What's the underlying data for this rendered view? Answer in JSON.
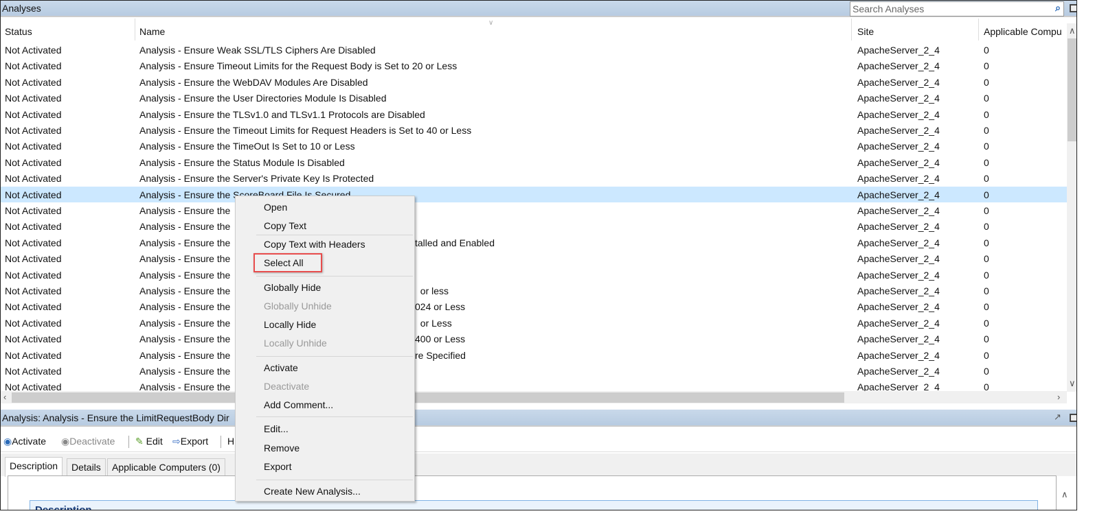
{
  "title": "Analyses",
  "search": {
    "placeholder": "Search Analyses",
    "icon": "search-icon"
  },
  "columns": [
    "Status",
    "Name",
    "Site",
    "Applicable Compu"
  ],
  "rows": [
    {
      "status": "Not Activated",
      "name": "Analysis - Ensure Weak SSL/TLS Ciphers Are Disabled",
      "suffix": "",
      "site": "ApacheServer_2_4",
      "count": "0"
    },
    {
      "status": "Not Activated",
      "name": "Analysis - Ensure Timeout Limits for the Request Body is Set to 20 or Less",
      "suffix": "",
      "site": "ApacheServer_2_4",
      "count": "0"
    },
    {
      "status": "Not Activated",
      "name": "Analysis - Ensure the WebDAV Modules Are Disabled",
      "suffix": "",
      "site": "ApacheServer_2_4",
      "count": "0"
    },
    {
      "status": "Not Activated",
      "name": "Analysis - Ensure the User Directories Module Is Disabled",
      "suffix": "",
      "site": "ApacheServer_2_4",
      "count": "0"
    },
    {
      "status": "Not Activated",
      "name": "Analysis - Ensure the TLSv1.0 and TLSv1.1 Protocols are Disabled",
      "suffix": "",
      "site": "ApacheServer_2_4",
      "count": "0"
    },
    {
      "status": "Not Activated",
      "name": "Analysis - Ensure the Timeout Limits for Request Headers is Set to 40 or Less",
      "suffix": "",
      "site": "ApacheServer_2_4",
      "count": "0"
    },
    {
      "status": "Not Activated",
      "name": "Analysis - Ensure the TimeOut Is Set to 10 or Less",
      "suffix": "",
      "site": "ApacheServer_2_4",
      "count": "0"
    },
    {
      "status": "Not Activated",
      "name": "Analysis - Ensure the Status Module Is Disabled",
      "suffix": "",
      "site": "ApacheServer_2_4",
      "count": "0"
    },
    {
      "status": "Not Activated",
      "name": "Analysis - Ensure the Server's Private Key Is Protected",
      "suffix": "",
      "site": "ApacheServer_2_4",
      "count": "0"
    },
    {
      "status": "Not Activated",
      "name": "Analysis - Ensure the ScoreBoard File Is Secured",
      "suffix": "",
      "site": "ApacheServer_2_4",
      "count": "0",
      "selected": true
    },
    {
      "status": "Not Activated",
      "name": "Analysis - Ensure the",
      "suffix": "",
      "site": "ApacheServer_2_4",
      "count": "0"
    },
    {
      "status": "Not Activated",
      "name": "Analysis - Ensure the",
      "suffix": "",
      "site": "ApacheServer_2_4",
      "count": "0"
    },
    {
      "status": "Not Activated",
      "name": "Analysis - Ensure the",
      "suffix": "talled and Enabled",
      "site": "ApacheServer_2_4",
      "count": "0"
    },
    {
      "status": "Not Activated",
      "name": "Analysis - Ensure the",
      "suffix": "",
      "site": "ApacheServer_2_4",
      "count": "0"
    },
    {
      "status": "Not Activated",
      "name": "Analysis - Ensure the",
      "suffix": "",
      "site": "ApacheServer_2_4",
      "count": "0"
    },
    {
      "status": "Not Activated",
      "name": "Analysis - Ensure the",
      "suffix": "  or less",
      "site": "ApacheServer_2_4",
      "count": "0"
    },
    {
      "status": "Not Activated",
      "name": "Analysis - Ensure the",
      "suffix": "024 or Less",
      "site": "ApacheServer_2_4",
      "count": "0"
    },
    {
      "status": "Not Activated",
      "name": "Analysis - Ensure the",
      "suffix": "  or Less",
      "site": "ApacheServer_2_4",
      "count": "0"
    },
    {
      "status": "Not Activated",
      "name": "Analysis - Ensure the",
      "suffix": "400 or Less",
      "site": "ApacheServer_2_4",
      "count": "0"
    },
    {
      "status": "Not Activated",
      "name": "Analysis - Ensure the",
      "suffix": "re Specified",
      "site": "ApacheServer_2_4",
      "count": "0"
    },
    {
      "status": "Not Activated",
      "name": "Analysis - Ensure the",
      "suffix": "",
      "site": "ApacheServer_2_4",
      "count": "0"
    },
    {
      "status": "Not Activated",
      "name": "Analysis - Ensure the",
      "suffix": "",
      "site": "ApacheServer_2_4",
      "count": "0"
    }
  ],
  "detail": {
    "title": "Analysis: Analysis - Ensure the LimitRequestBody Dir",
    "toolbar": {
      "activate": "Activate",
      "deactivate": "Deactivate",
      "edit": "Edit",
      "export": "Export",
      "hide": "H"
    },
    "tabs": [
      "Description",
      "Details",
      "Applicable Computers (0)"
    ],
    "section": "Description"
  },
  "context_menu": {
    "items": [
      {
        "label": "Open",
        "enabled": true
      },
      {
        "label": "Copy Text",
        "enabled": true
      },
      {
        "label": "Copy Text with Headers",
        "enabled": true
      },
      {
        "label": "Select All",
        "enabled": true,
        "highlighted": true
      },
      {
        "label": "Globally Hide",
        "enabled": true
      },
      {
        "label": "Globally Unhide",
        "enabled": false
      },
      {
        "label": "Locally Hide",
        "enabled": true
      },
      {
        "label": "Locally Unhide",
        "enabled": false
      },
      {
        "label": "Activate",
        "enabled": true
      },
      {
        "label": "Deactivate",
        "enabled": false
      },
      {
        "label": "Add Comment...",
        "enabled": true
      },
      {
        "label": "Edit...",
        "enabled": true
      },
      {
        "label": "Remove",
        "enabled": true
      },
      {
        "label": "Export",
        "enabled": true
      },
      {
        "label": "Create New Analysis...",
        "enabled": true
      }
    ]
  },
  "colors": {
    "selection": "#cce8ff",
    "highlight_box": "#e84c4c",
    "pane_header": "#c0d2e6"
  }
}
